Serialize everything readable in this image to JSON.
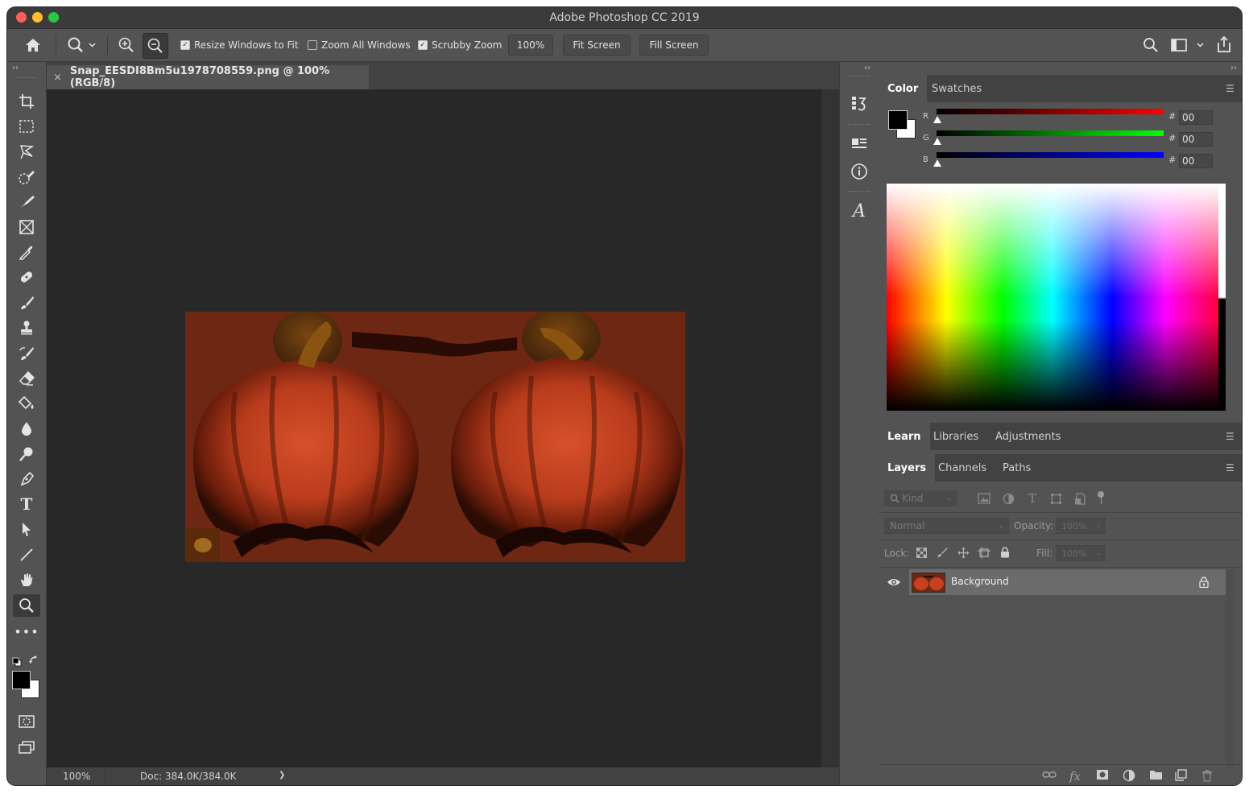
{
  "window": {
    "title": "Adobe Photoshop CC 2019"
  },
  "options_bar": {
    "resize_windows_label": "Resize Windows to Fit",
    "resize_windows_checked": true,
    "zoom_all_label": "Zoom All Windows",
    "zoom_all_checked": false,
    "scrubby_zoom_label": "Scrubby Zoom",
    "scrubby_zoom_checked": true,
    "zoom_value": "100%",
    "fit_screen_label": "Fit Screen",
    "fill_screen_label": "Fill Screen"
  },
  "document": {
    "tab_close": "×",
    "tab_label": "Snap_EESDI8Bm5u1978708559.png @ 100% (RGB/8)",
    "status_zoom": "100%",
    "status_doc": "Doc: 384.0K/384.0K",
    "status_arrow": "❯"
  },
  "color_panel": {
    "tabs": [
      "Color",
      "Swatches"
    ],
    "channels": [
      {
        "label": "R",
        "value": "00",
        "color": "#ff0000"
      },
      {
        "label": "G",
        "value": "00",
        "color": "#00ff00"
      },
      {
        "label": "B",
        "value": "00",
        "color": "#0000ff"
      }
    ],
    "hash": "#",
    "foreground": "#000000",
    "background": "#ffffff"
  },
  "learn_panel": {
    "tabs": [
      "Learn",
      "Libraries",
      "Adjustments"
    ]
  },
  "layers_panel": {
    "tabs": [
      "Layers",
      "Channels",
      "Paths"
    ],
    "filter_placeholder": "Kind",
    "blend_mode": "Normal",
    "opacity_label": "Opacity:",
    "opacity_value": "100%",
    "lock_label": "Lock:",
    "fill_label": "Fill:",
    "fill_value": "100%",
    "layers": [
      {
        "name": "Background",
        "visible": true,
        "locked": true
      }
    ]
  },
  "colors": {
    "window_bg": "#535353",
    "canvas_bg": "#282828",
    "image_bg": "#6e2712",
    "pumpkin": "#c8401f"
  }
}
